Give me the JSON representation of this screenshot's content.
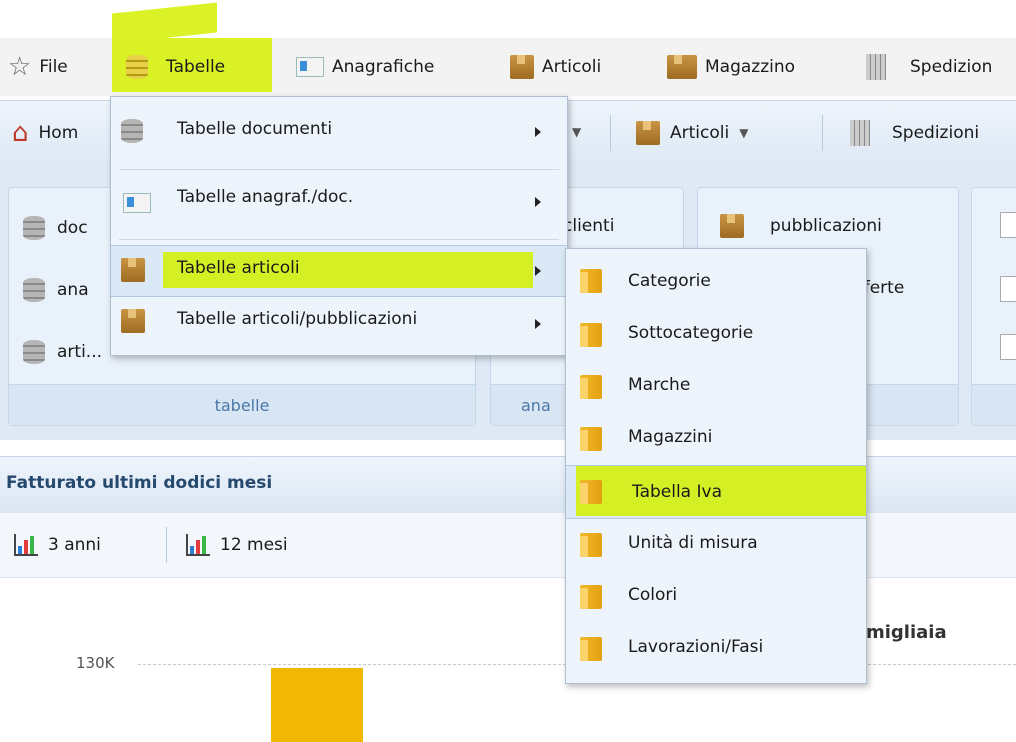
{
  "menubar": {
    "items": [
      {
        "label": "File",
        "icon": "star-icon"
      },
      {
        "label": "Tabelle",
        "icon": "database-icon"
      },
      {
        "label": "Anagrafiche",
        "icon": "contact-card-icon"
      },
      {
        "label": "Articoli",
        "icon": "package-icon"
      },
      {
        "label": "Magazzino",
        "icon": "boxes-icon"
      },
      {
        "label": "Spedizion",
        "icon": "building-icon"
      }
    ]
  },
  "toolbar": {
    "home": "Hom",
    "articoli": "Articoli",
    "spedizioni": "Spedizioni"
  },
  "ribbon": {
    "group1": {
      "items": [
        "doc",
        "ana",
        "arti..."
      ],
      "footer": "tabelle"
    },
    "group2": {
      "items": [
        "clienti"
      ],
      "footer": "ana"
    },
    "group3": {
      "items": [
        "pubblicazioni",
        "fferte"
      ]
    }
  },
  "menu_tabelle": {
    "items": [
      {
        "label": "Tabelle documenti"
      },
      {
        "label": "Tabelle anagraf./doc."
      },
      {
        "label": "Tabelle articoli"
      },
      {
        "label": "Tabelle articoli/pubblicazioni"
      }
    ]
  },
  "submenu_articoli": {
    "items": [
      "Categorie",
      "Sottocategorie",
      "Marche",
      "Magazzini",
      "Tabella Iva",
      "Unità di misura",
      "Colori",
      "Lavorazioni/Fasi"
    ]
  },
  "panel": {
    "title": "Fatturato ultimi dodici mesi",
    "btn_3anni": "3 anni",
    "btn_12mesi": "12 mesi",
    "chart_title_fragment": "migliaia",
    "ytick": "130K"
  },
  "colors": {
    "highlight": "#d4f000",
    "bar": "#f2b705",
    "accent": "#4a78a8"
  }
}
